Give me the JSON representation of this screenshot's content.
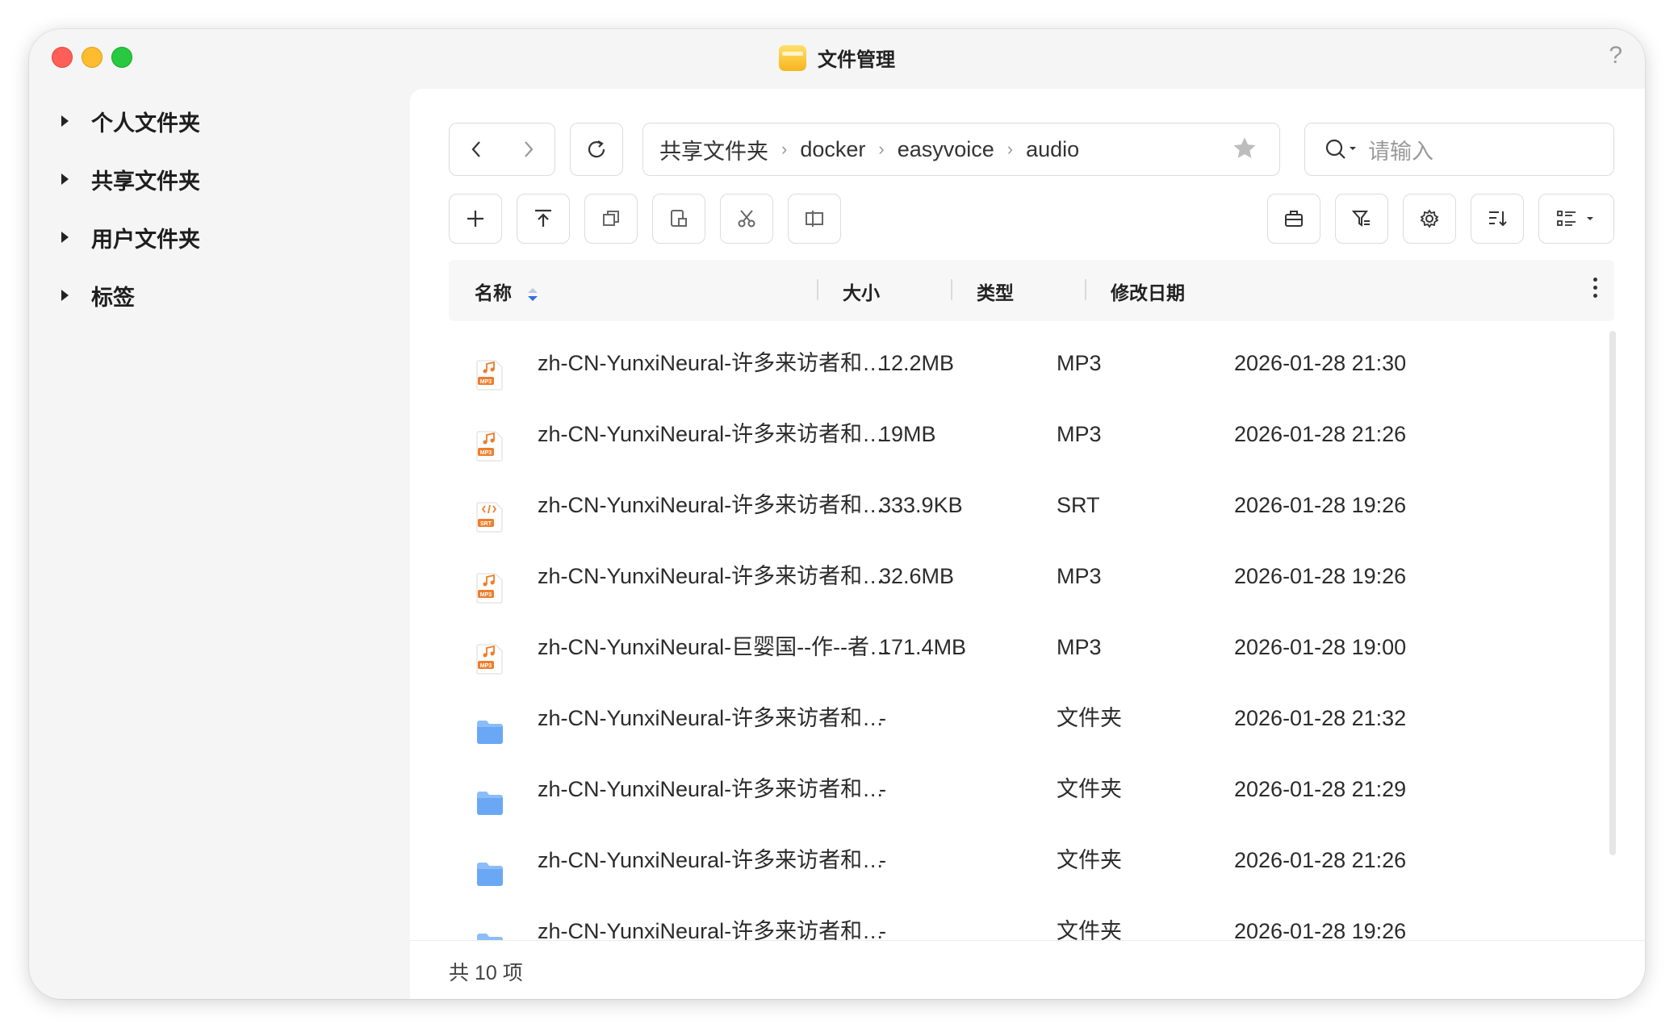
{
  "window": {
    "title": "文件管理",
    "help": "?"
  },
  "sidebar": {
    "items": [
      {
        "label": "个人文件夹"
      },
      {
        "label": "共享文件夹"
      },
      {
        "label": "用户文件夹"
      },
      {
        "label": "标签"
      }
    ]
  },
  "breadcrumb": [
    "共享文件夹",
    "docker",
    "easyvoice",
    "audio"
  ],
  "search": {
    "placeholder": "请输入"
  },
  "table": {
    "headers": {
      "name": "名称",
      "size": "大小",
      "type": "类型",
      "date": "修改日期"
    },
    "rows": [
      {
        "icon": "mp3-file-icon",
        "badge": "MP3",
        "name": "zh-CN-YunxiNeural-许多来访者和…",
        "size": "12.2MB",
        "type": "MP3",
        "date": "2026-01-28 21:30"
      },
      {
        "icon": "mp3-file-icon",
        "badge": "MP3",
        "name": "zh-CN-YunxiNeural-许多来访者和…",
        "size": "19MB",
        "type": "MP3",
        "date": "2026-01-28 21:26"
      },
      {
        "icon": "srt-file-icon",
        "badge": "SRT",
        "name": "zh-CN-YunxiNeural-许多来访者和…",
        "size": "333.9KB",
        "type": "SRT",
        "date": "2026-01-28 19:26"
      },
      {
        "icon": "mp3-file-icon",
        "badge": "MP3",
        "name": "zh-CN-YunxiNeural-许多来访者和…",
        "size": "32.6MB",
        "type": "MP3",
        "date": "2026-01-28 19:26"
      },
      {
        "icon": "mp3-file-icon",
        "badge": "MP3",
        "name": "zh-CN-YunxiNeural-巨婴国--作--者…",
        "size": "171.4MB",
        "type": "MP3",
        "date": "2026-01-28 19:00"
      },
      {
        "icon": "folder-icon",
        "name": "zh-CN-YunxiNeural-许多来访者和…",
        "size": "-",
        "type": "文件夹",
        "date": "2026-01-28 21:32"
      },
      {
        "icon": "folder-icon",
        "name": "zh-CN-YunxiNeural-许多来访者和…",
        "size": "-",
        "type": "文件夹",
        "date": "2026-01-28 21:29"
      },
      {
        "icon": "folder-icon",
        "name": "zh-CN-YunxiNeural-许多来访者和…",
        "size": "-",
        "type": "文件夹",
        "date": "2026-01-28 21:26"
      },
      {
        "icon": "folder-icon",
        "name": "zh-CN-YunxiNeural-许多来访者和…",
        "size": "-",
        "type": "文件夹",
        "date": "2026-01-28 19:26"
      }
    ]
  },
  "footer": {
    "count": "共 10 项"
  },
  "colors": {
    "accent": "#2f6fe0",
    "file_orange": "#ee7d2b",
    "folder_blue": "#6aa8f5"
  }
}
